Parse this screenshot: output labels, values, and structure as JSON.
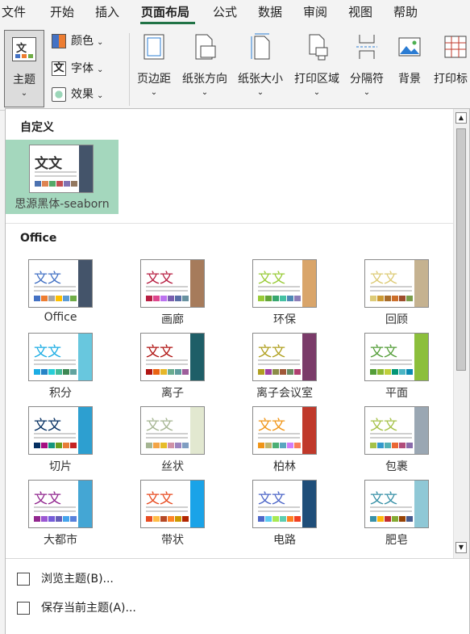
{
  "menu": {
    "items": [
      "文件",
      "开始",
      "插入",
      "页面布局",
      "公式",
      "数据",
      "审阅",
      "视图",
      "帮助"
    ],
    "active_index": 3
  },
  "ribbon": {
    "theme_button": "主题",
    "theme_icon_text": "文",
    "sub_buttons": [
      "颜色",
      "字体",
      "效果"
    ],
    "font_icon_text": "文",
    "buttons": [
      "页边距",
      "纸张方向",
      "纸张大小",
      "打印区域",
      "分隔符",
      "背景",
      "打印标"
    ]
  },
  "panel": {
    "custom_title": "自定义",
    "custom_theme": {
      "name": "思源黑体-seaborn"
    },
    "office_title": "Office",
    "thumb_text": "文文",
    "themes": [
      {
        "name": "Office",
        "accent": "#44546a",
        "swatches": [
          "#4472c4",
          "#ed7d31",
          "#a5a5a5",
          "#ffc000",
          "#5b9bd5",
          "#70ad47"
        ]
      },
      {
        "name": "画廊",
        "accent": "#a67b5b",
        "swatches": [
          "#b71e42",
          "#de478e",
          "#bc72f0",
          "#795faf",
          "#586ea6",
          "#6892a0"
        ]
      },
      {
        "name": "环保",
        "accent": "#d9a56a",
        "swatches": [
          "#99cb38",
          "#63a537",
          "#37a76f",
          "#44c1a3",
          "#4e88b4",
          "#8c7db8"
        ]
      },
      {
        "name": "回顾",
        "accent": "#c5b290",
        "swatches": [
          "#ddcb77",
          "#cc9a34",
          "#a86c2a",
          "#cc6f2b",
          "#9d4d2c",
          "#7a9d4a"
        ]
      },
      {
        "name": "积分",
        "accent": "#68c7de",
        "swatches": [
          "#1cade4",
          "#2683c6",
          "#27ced7",
          "#42ba97",
          "#3e8853",
          "#62a39f"
        ]
      },
      {
        "name": "离子",
        "accent": "#1e5e67",
        "swatches": [
          "#b01513",
          "#ea6312",
          "#e6b729",
          "#6aac90",
          "#5f9c9d",
          "#9e5e9b"
        ]
      },
      {
        "name": "离子会议室",
        "accent": "#7a3b69",
        "swatches": [
          "#b0a020",
          "#a040a0",
          "#8c8c48",
          "#a05838",
          "#6c8c60",
          "#b04070"
        ]
      },
      {
        "name": "平面",
        "accent": "#8cbf3c",
        "swatches": [
          "#549e39",
          "#8ab833",
          "#c0cf3a",
          "#029676",
          "#4ab5c4",
          "#0989b1"
        ]
      },
      {
        "name": "切片",
        "accent": "#2d9fd0",
        "swatches": [
          "#052f61",
          "#a50e82",
          "#14967c",
          "#6a9e1f",
          "#e87d37",
          "#c62324"
        ]
      },
      {
        "name": "丝状",
        "accent": "#e2e8d0",
        "swatches": [
          "#a5b592",
          "#f3a447",
          "#e7bc29",
          "#d092a7",
          "#9c85c0",
          "#809ec2"
        ]
      },
      {
        "name": "柏林",
        "accent": "#c0392b",
        "swatches": [
          "#f09415",
          "#c1b56b",
          "#4baf73",
          "#5aa6c0",
          "#d17df9",
          "#fa7e5c"
        ]
      },
      {
        "name": "包裹",
        "accent": "#9aa7b3",
        "swatches": [
          "#a5c249",
          "#3399cc",
          "#53b1b4",
          "#ea6834",
          "#b14c7b",
          "#8a6baa"
        ]
      },
      {
        "name": "大都市",
        "accent": "#44a6d4",
        "swatches": [
          "#92278f",
          "#9b57d3",
          "#755dd9",
          "#665eb8",
          "#45a5ed",
          "#5982db"
        ]
      },
      {
        "name": "带状",
        "accent": "#1aa3e8",
        "swatches": [
          "#e84c22",
          "#ffbd47",
          "#b64926",
          "#ff8427",
          "#cc9900",
          "#b22600"
        ]
      },
      {
        "name": "电路",
        "accent": "#1f4e79",
        "swatches": [
          "#4e67c8",
          "#5eccf3",
          "#a7ea52",
          "#5dceaf",
          "#ff8021",
          "#f14124"
        ]
      },
      {
        "name": "肥皂",
        "accent": "#8fc8d6",
        "swatches": [
          "#3891a7",
          "#feb80a",
          "#c32d2e",
          "#84aa33",
          "#964305",
          "#475a8d"
        ]
      }
    ]
  },
  "footer": {
    "browse": "浏览主题(B)...",
    "save": "保存当前主题(A)..."
  }
}
